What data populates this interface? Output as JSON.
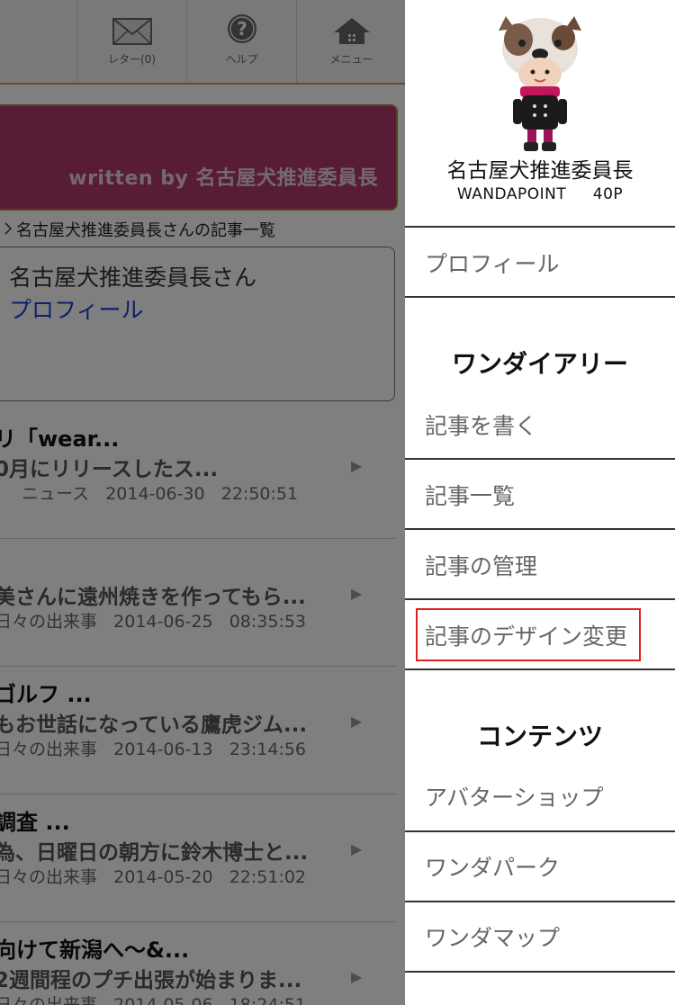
{
  "toolbar": {
    "letter_label": "レター(0)",
    "help_label": "ヘルプ",
    "menu_label": "メニュー"
  },
  "banner": {
    "text": "written by 名古屋犬推進委員長"
  },
  "breadcrumb": {
    "text": "名古屋犬推進委員長さんの記事一覧"
  },
  "profile_box": {
    "name": "名古屋犬推進委員長さん",
    "link": "プロフィール"
  },
  "articles": [
    {
      "title": "リ「wear...",
      "excerpt": "0月にリリースしたス...",
      "category": "ニュース",
      "date": "2014-06-30",
      "time": "22:50:51"
    },
    {
      "title": "",
      "excerpt": "美さんに遠州焼きを作ってもら...",
      "category": "日々の出来事",
      "date": "2014-06-25",
      "time": "08:35:53"
    },
    {
      "title": "ゴルフ ...",
      "excerpt": "もお世話になっている鷹虎ジム...",
      "category": "日々の出来事",
      "date": "2014-06-13",
      "time": "23:14:56"
    },
    {
      "title": "調査 ...",
      "excerpt": "為、日曜日の朝方に鈴木博士と...",
      "category": "日々の出来事",
      "date": "2014-05-20",
      "time": "22:51:02"
    },
    {
      "title": "向けて新潟へ〜&...",
      "excerpt": "2週間程のプチ出張が始まりま...",
      "category": "日々の出来事",
      "date": "2014-05-06",
      "time": "18:24:51"
    }
  ],
  "menu": {
    "user_name": "名古屋犬推進委員長",
    "points_label": "WANDAPOINT",
    "points_value": "40P",
    "profile": "プロフィール",
    "diary_heading": "ワンダイアリー",
    "diary_items": [
      "記事を書く",
      "記事一覧",
      "記事の管理",
      "記事のデザイン変更"
    ],
    "contents_heading": "コンテンツ",
    "contents_items": [
      "アバターショップ",
      "ワンダパーク",
      "ワンダマップ"
    ]
  },
  "colors": {
    "banner": "#b3386f",
    "link": "#1a3fd6",
    "highlight": "#e02020"
  }
}
